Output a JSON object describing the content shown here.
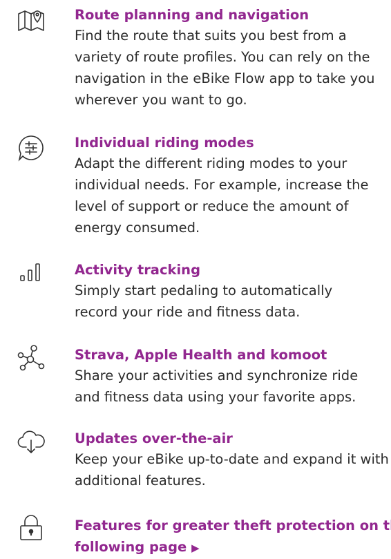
{
  "accent_color": "#92278f",
  "features": [
    {
      "icon": "map-pin-icon",
      "title": "Route planning and navigation",
      "lines": [
        "Find the route that suits you best from a",
        "variety of route profiles. You can rely on the",
        "navigation in the eBike Flow app to take you",
        "wherever you want to go."
      ]
    },
    {
      "icon": "sliders-icon",
      "title": "Individual riding modes",
      "lines": [
        "Adapt the different riding modes to your",
        "individual needs. For example, increase the",
        "level of support or reduce the amount of",
        "energy consumed."
      ]
    },
    {
      "icon": "bar-chart-icon",
      "title": "Activity tracking",
      "lines": [
        "Simply start pedaling to automatically",
        "record your ride and fitness data."
      ]
    },
    {
      "icon": "network-share-icon",
      "title": "Strava, Apple Health and komoot",
      "lines": [
        "Share your activities and synchronize ride",
        "and fitness data using your favorite apps."
      ]
    },
    {
      "icon": "cloud-download-icon",
      "title": "Updates over-the-air",
      "lines": [
        "Keep your eBike up-to-date and expand it with",
        "additional features."
      ]
    },
    {
      "icon": "padlock-icon",
      "title_lines": [
        "Features for greater theft protection on the",
        "following page"
      ],
      "arrow": "▶"
    }
  ]
}
